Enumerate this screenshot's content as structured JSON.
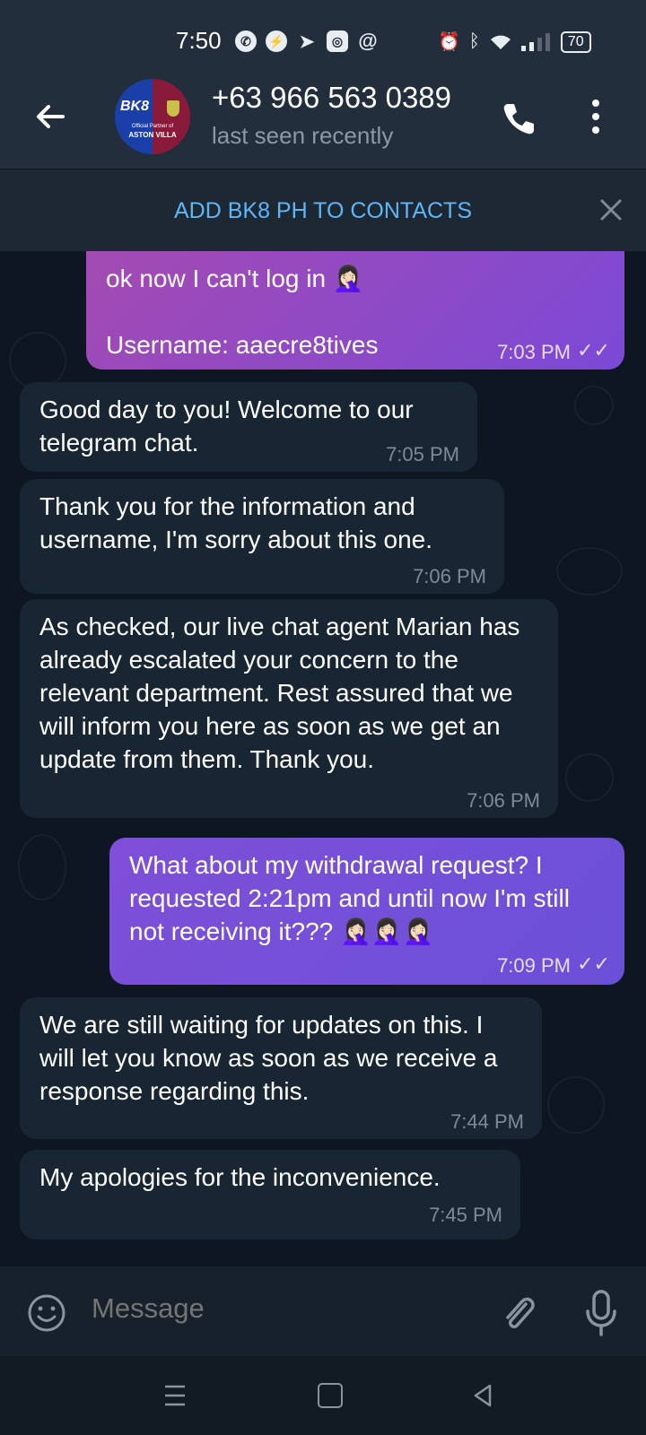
{
  "status_bar": {
    "time": "7:50",
    "left_icons": [
      "whatsapp-icon",
      "messenger-icon",
      "telegram-icon",
      "instagram-icon",
      "threads-icon"
    ],
    "right_icons": [
      "alarm-icon",
      "bluetooth-icon",
      "wifi-icon",
      "signal-icon"
    ],
    "battery": "70"
  },
  "header": {
    "title": "+63 966 563 0389",
    "subtitle": "last seen recently",
    "avatar": {
      "brand": "BK8",
      "line1": "Official Partner of",
      "line2": "ASTON VILLA"
    }
  },
  "add_contact": {
    "label": "ADD BK8 PH TO CONTACTS"
  },
  "messages": [
    {
      "side": "out",
      "text": "ok now I can't log in 🤦🏻‍♀️\n\nUsername: aaecre8tives",
      "time": "7:03 PM",
      "status": "read"
    },
    {
      "side": "in",
      "text": "Good day to you! Welcome to our telegram chat.",
      "time": "7:05 PM"
    },
    {
      "side": "in",
      "text": "Thank you for the information and username, I'm sorry about this one.",
      "time": "7:06 PM"
    },
    {
      "side": "in",
      "text": "As checked, our live chat agent Marian has already escalated your concern to the relevant department. Rest assured that we will inform you here as soon as we get an update from them. Thank you.",
      "time": "7:06 PM"
    },
    {
      "side": "out",
      "text": "What about my withdrawal request? I requested 2:21pm and until now I'm still not receiving it??? 🤦🏻‍♀️🤦🏻‍♀️🤦🏻‍♀️",
      "time": "7:09 PM",
      "status": "read"
    },
    {
      "side": "in",
      "text": "We are still waiting for updates on this. I will let you know as soon as we receive a response regarding this.",
      "time": "7:44 PM"
    },
    {
      "side": "in",
      "text": "My apologies for the inconvenience.",
      "time": "7:45 PM"
    }
  ],
  "input": {
    "placeholder": "Message"
  },
  "colors": {
    "header_bg": "#232e3c",
    "chat_bg": "#0e1621",
    "incoming_bubble": "#182533",
    "outgoing_bubble_start": "#a64bb0",
    "outgoing_bubble_end": "#7b49d6",
    "link_blue": "#5eb5f7",
    "muted_text": "#7d8b99"
  }
}
